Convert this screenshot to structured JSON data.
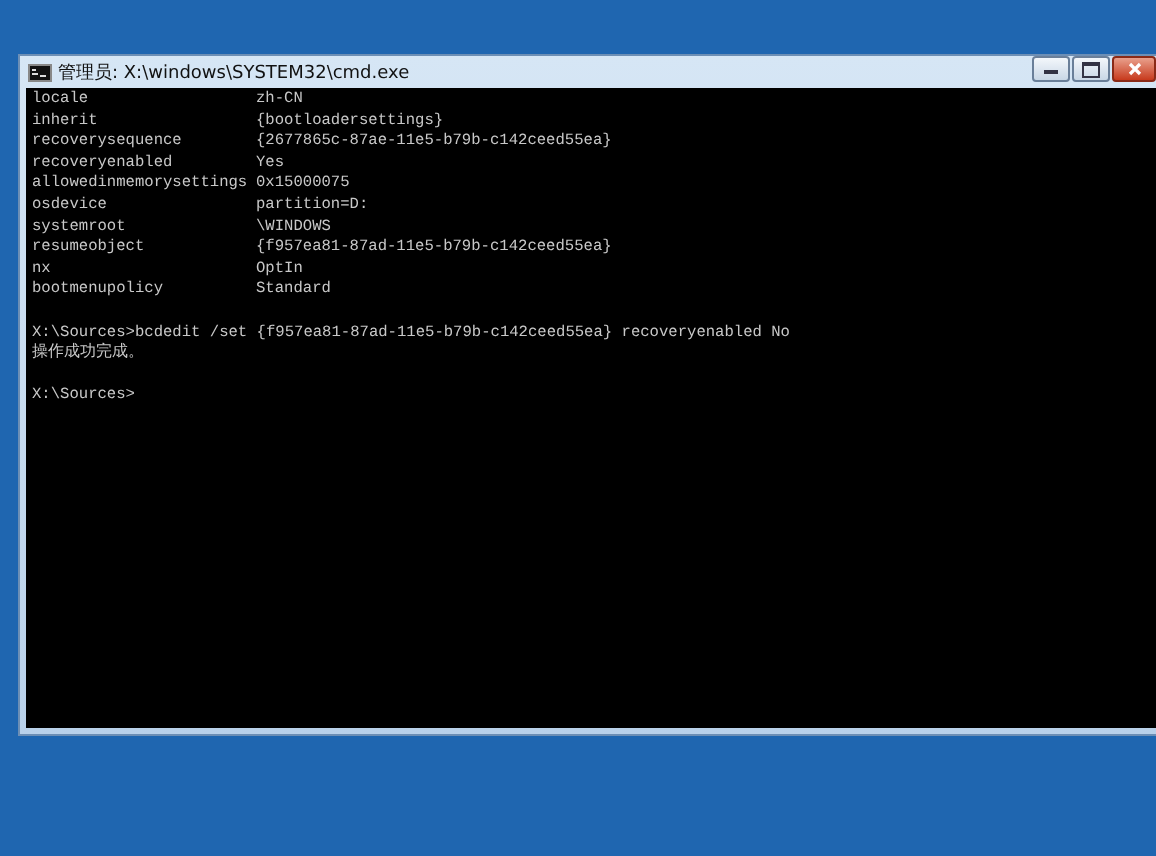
{
  "window": {
    "title": "管理员: X:\\windows\\SYSTEM32\\cmd.exe"
  },
  "console": {
    "lines": [
      {
        "kind": "property",
        "name": "locale",
        "value": "zh-CN"
      },
      {
        "kind": "property",
        "name": "inherit",
        "value": "{bootloadersettings}"
      },
      {
        "kind": "property",
        "name": "recoverysequence",
        "value": "{2677865c-87ae-11e5-b79b-c142ceed55ea}"
      },
      {
        "kind": "property",
        "name": "recoveryenabled",
        "value": "Yes"
      },
      {
        "kind": "property",
        "name": "allowedinmemorysettings",
        "value": "0x15000075"
      },
      {
        "kind": "property",
        "name": "osdevice",
        "value": "partition=D:"
      },
      {
        "kind": "property",
        "name": "systemroot",
        "value": "\\WINDOWS"
      },
      {
        "kind": "property",
        "name": "resumeobject",
        "value": "{f957ea81-87ad-11e5-b79b-c142ceed55ea}"
      },
      {
        "kind": "property",
        "name": "nx",
        "value": "OptIn"
      },
      {
        "kind": "property",
        "name": "bootmenupolicy",
        "value": "Standard"
      },
      {
        "kind": "blank"
      },
      {
        "kind": "text",
        "text": "X:\\Sources>bcdedit /set {f957ea81-87ad-11e5-b79b-c142ceed55ea} recoveryenabled No"
      },
      {
        "kind": "text",
        "text": "操作成功完成。"
      },
      {
        "kind": "blank"
      },
      {
        "kind": "text",
        "text": "X:\\Sources>"
      }
    ]
  }
}
